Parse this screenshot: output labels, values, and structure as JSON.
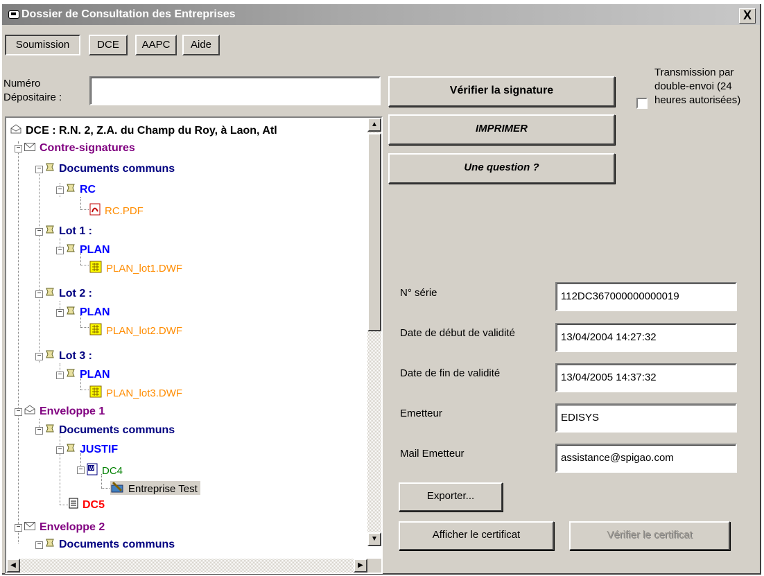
{
  "window": {
    "title": "Dossier de Consultation des Entreprises",
    "close_label": "X"
  },
  "menu": [
    {
      "label": "Soumission"
    },
    {
      "label": "DCE"
    },
    {
      "label": "AAPC"
    },
    {
      "label": "Aide"
    }
  ],
  "depositaire": {
    "label_line1": "Numéro",
    "label_line2": "Dépositaire :",
    "value": ""
  },
  "buttons": {
    "verifier_signature": "Vérifier la signature",
    "imprimer": "IMPRIMER",
    "question": "Une question ?",
    "exporter": "Exporter...",
    "afficher_certificat": "Afficher le certificat",
    "verifier_certificat": "Vérifier le certificat"
  },
  "transmission": {
    "line1": "Transmission par",
    "line2": "double-envoi (24",
    "line3": "heures autorisées)",
    "checked": false
  },
  "certificate": {
    "serie_label": "N° série",
    "serie_value": "112DC367000000000019",
    "debut_label": "Date de début de validité",
    "debut_value": "13/04/2004 14:27:32",
    "fin_label": "Date de fin de validité",
    "fin_value": "13/04/2005 14:37:32",
    "emetteur_label": "Emetteur",
    "emetteur_value": "EDISYS",
    "mail_label": "Mail Emetteur",
    "mail_value": "assistance@spigao.com"
  },
  "tree": {
    "root": "DCE : R.N. 2, Z.A. du Champ du Roy, à Laon, Atl",
    "n1": "Contre-signatures",
    "n2": "Documents communs",
    "n3": "RC",
    "n4": "RC.PDF",
    "n5": "Lot 1 :",
    "n6": "PLAN",
    "n7": "PLAN_lot1.DWF",
    "n8": "Lot 2 :",
    "n9": "PLAN",
    "n10": "PLAN_lot2.DWF",
    "n11": "Lot 3 :",
    "n12": "PLAN",
    "n13": "PLAN_lot3.DWF",
    "n14": "Enveloppe 1",
    "n15": "Documents communs",
    "n16": "JUSTIF",
    "n17": "DC4",
    "n18": "Entreprise Test",
    "n19": "DC5",
    "n20": "Enveloppe 2",
    "n21": "Documents communs"
  },
  "colors": {
    "purple": "#800080",
    "navy": "#000080",
    "blue": "#0000ff",
    "orange": "#ff8c00",
    "green": "#008000",
    "red": "#ff0000"
  }
}
